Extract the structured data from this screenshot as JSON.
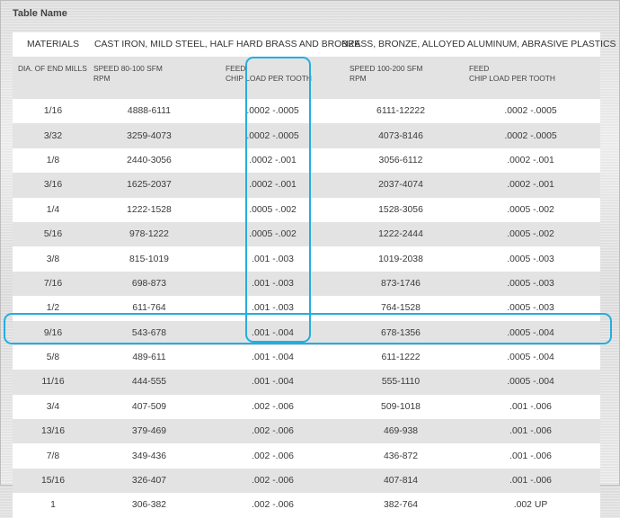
{
  "title": "Table Name",
  "header": {
    "materials": "MATERIALS",
    "group1": "CAST IRON, MILD STEEL, HALF HARD BRASS AND BRONZE",
    "group2": "BRASS, BRONZE, ALLOYED ALUMINUM, ABRASIVE PLASTICS"
  },
  "subheader": {
    "dia": "DIA. OF END MILLS",
    "speed1_line1": "SPEED 80-100 SFM",
    "speed1_line2": "RPM",
    "feed1_line1": "FEED",
    "feed1_line2": "CHIP LOAD PER TOOTH",
    "speed2_line1": "SPEED 100-200 SFM",
    "speed2_line2": "RPM",
    "feed2_line1": "FEED",
    "feed2_line2": "CHIP LOAD PER TOOTH"
  },
  "rows": [
    {
      "dia": "1/16",
      "rpm1": "4888-6111",
      "feed1": ".0002 -.0005",
      "rpm2": "6111-12222",
      "feed2": ".0002 -.0005"
    },
    {
      "dia": "3/32",
      "rpm1": "3259-4073",
      "feed1": ".0002 -.0005",
      "rpm2": "4073-8146",
      "feed2": ".0002 -.0005"
    },
    {
      "dia": "1/8",
      "rpm1": "2440-3056",
      "feed1": ".0002 -.001",
      "rpm2": "3056-6112",
      "feed2": ".0002 -.001"
    },
    {
      "dia": "3/16",
      "rpm1": "1625-2037",
      "feed1": ".0002 -.001",
      "rpm2": "2037-4074",
      "feed2": ".0002 -.001"
    },
    {
      "dia": "1/4",
      "rpm1": "1222-1528",
      "feed1": ".0005 -.002",
      "rpm2": "1528-3056",
      "feed2": ".0005 -.002"
    },
    {
      "dia": "5/16",
      "rpm1": "978-1222",
      "feed1": ".0005 -.002",
      "rpm2": "1222-2444",
      "feed2": ".0005 -.002"
    },
    {
      "dia": "3/8",
      "rpm1": "815-1019",
      "feed1": ".001 -.003",
      "rpm2": "1019-2038",
      "feed2": ".0005 -.003"
    },
    {
      "dia": "7/16",
      "rpm1": "698-873",
      "feed1": ".001 -.003",
      "rpm2": "873-1746",
      "feed2": ".0005 -.003"
    },
    {
      "dia": "1/2",
      "rpm1": "611-764",
      "feed1": ".001 -.003",
      "rpm2": "764-1528",
      "feed2": ".0005 -.003"
    },
    {
      "dia": "9/16",
      "rpm1": "543-678",
      "feed1": ".001 -.004",
      "rpm2": "678-1356",
      "feed2": ".0005 -.004"
    },
    {
      "dia": "5/8",
      "rpm1": "489-611",
      "feed1": ".001 -.004",
      "rpm2": "611-1222",
      "feed2": ".0005 -.004"
    },
    {
      "dia": "11/16",
      "rpm1": "444-555",
      "feed1": ".001 -.004",
      "rpm2": "555-1110",
      "feed2": ".0005 -.004"
    },
    {
      "dia": "3/4",
      "rpm1": "407-509",
      "feed1": ".002 -.006",
      "rpm2": "509-1018",
      "feed2": ".001 -.006"
    },
    {
      "dia": "13/16",
      "rpm1": "379-469",
      "feed1": ".002 -.006",
      "rpm2": "469-938",
      "feed2": ".001 -.006"
    },
    {
      "dia": "7/8",
      "rpm1": "349-436",
      "feed1": ".002 -.006",
      "rpm2": "436-872",
      "feed2": ".001 -.006"
    },
    {
      "dia": "15/16",
      "rpm1": "326-407",
      "feed1": ".002 -.006",
      "rpm2": "407-814",
      "feed2": ".001 -.006"
    },
    {
      "dia": "1",
      "rpm1": "306-382",
      "feed1": ".002 -.006",
      "rpm2": "382-764",
      "feed2": ".002 UP"
    }
  ],
  "colors": {
    "highlight": "#23aee0",
    "row_stripe": "#e3e3e3"
  }
}
